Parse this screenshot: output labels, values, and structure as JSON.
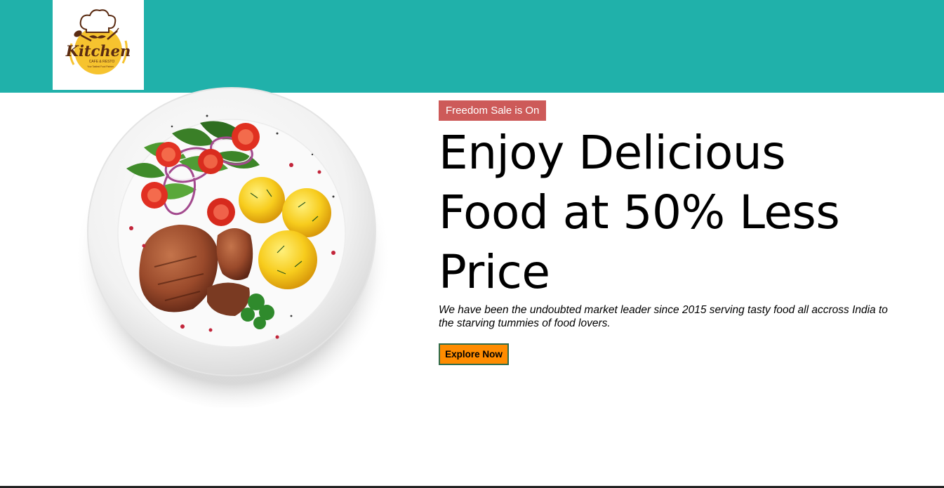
{
  "header": {
    "logo": {
      "name": "Kitchen",
      "subtitle": "CAFE & RESTO",
      "slogan": "Your Tastiest Food Partner",
      "icon": "chef-hat-icon",
      "colors": {
        "disc": "#f6c32f",
        "text": "#5a2b12"
      }
    },
    "background_color": "#20b1aa"
  },
  "hero": {
    "image": "food-plate-icon",
    "badge": "Freedom Sale is On",
    "badge_color": "#cd5a59",
    "headline": "Enjoy Delicious Food at 50% Less Price",
    "tagline": "We have been the undoubted market leader since 2015 serving tasty food all accross India to the starving tummies of food lovers.",
    "cta_label": "Explore Now",
    "cta_color": "#ff8c00"
  }
}
